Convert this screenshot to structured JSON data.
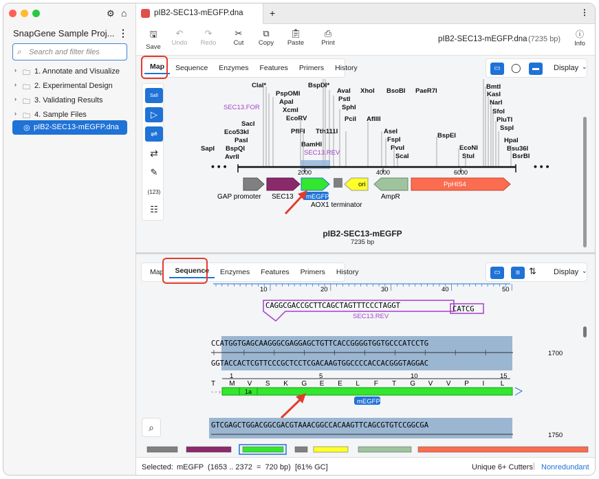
{
  "sidebar": {
    "title": "SnapGene Sample Proj...",
    "search_placeholder": "Search and filter files",
    "items": [
      {
        "label": "1. Annotate and Visualize"
      },
      {
        "label": "2. Experimental Design"
      },
      {
        "label": "3. Validating Results"
      },
      {
        "label": "4. Sample Files"
      },
      {
        "label": "pIB2-SEC13-mEGFP.dna"
      }
    ]
  },
  "tab": {
    "title": "pIB2-SEC13-mEGFP.dna",
    "new": "+"
  },
  "toolbar": {
    "save": "Save",
    "undo": "Undo",
    "redo": "Redo",
    "cut": "Cut",
    "copy": "Copy",
    "paste": "Paste",
    "print": "Print",
    "info": "Info",
    "file": "pIB2-SEC13-mEGFP.dna",
    "size": "(7235 bp)"
  },
  "map_tabs": [
    "Map",
    "Sequence",
    "Enzymes",
    "Features",
    "Primers",
    "History"
  ],
  "display": "Display",
  "map": {
    "name": "pIB2-SEC13-mEGFP",
    "length": "7235 bp",
    "ticks": [
      "2000",
      "4000",
      "6000"
    ],
    "highlight": "mEGFP",
    "enzymes": [
      "ClaI*",
      "BspDI*",
      "PspOMI",
      "ApaI",
      "XcmI",
      "EcoRV",
      "PflFI",
      "BamHI",
      "AvaI",
      "PstI",
      "SphI",
      "PciI",
      "Tth111I",
      "XhoI",
      "BsoBI",
      "PaeR7I",
      "AflIII",
      "AseI",
      "FspI",
      "PvuI",
      "ScaI",
      "BspEI",
      "EcoNI",
      "StuI",
      "BmtI",
      "KasI",
      "NarI",
      "SfoI",
      "PluTI",
      "SspI",
      "HpaI",
      "Bsu36I",
      "BsrBI",
      "SacI",
      "Eco53kI",
      "PasI",
      "BspQI",
      "AvrII",
      "SapI"
    ],
    "primers": [
      "SEC13.FOR",
      "SEC13.REV"
    ],
    "features": [
      "GAP promoter",
      "SEC13",
      "AOX1 terminator",
      "ori",
      "AmpR",
      "PpHIS4"
    ]
  },
  "left_tools": [
    "SalI",
    "(123)"
  ],
  "seq": {
    "ruler": [
      "10",
      "20",
      "30",
      "40",
      "50"
    ],
    "primer_seq": "CAGGCGACCGCTTCAGCTAGTTTCCCTAGGT",
    "primer_tail": "CATCG",
    "primer_name": "SEC13.REV",
    "top1": "CCATGGTGAGCAAGGGCGAGGAGCTGTTCACCGGGGTGGTGCCCATCCTG",
    "bot1": "GGTACCACTCGTTCCCGCTCCTCGACAAGTGGCCCCACCACGGGTAGGAC",
    "pos1": "1700",
    "aa_nums": [
      "1",
      "5",
      "10",
      "15"
    ],
    "aa": [
      "T",
      "M",
      "V",
      "S",
      "K",
      "G",
      "E",
      "E",
      "L",
      "F",
      "T",
      "G",
      "V",
      "V",
      "P",
      "I",
      "L"
    ],
    "feat_label": "1a",
    "feat_name": "mEGFP",
    "top2": "GTCGAGCTGGACGGCGACGTAAACGGCCACAAGTTCAGCGTGTCCGGCGA",
    "pos2": "1750"
  },
  "status": {
    "label": "Selected:",
    "value": "mEGFP  (1653 .. 2372  =  720 bp)",
    "gc": "[61% GC]",
    "cutters": "Unique 6+ Cutters",
    "nonred": "Nonredundant"
  }
}
